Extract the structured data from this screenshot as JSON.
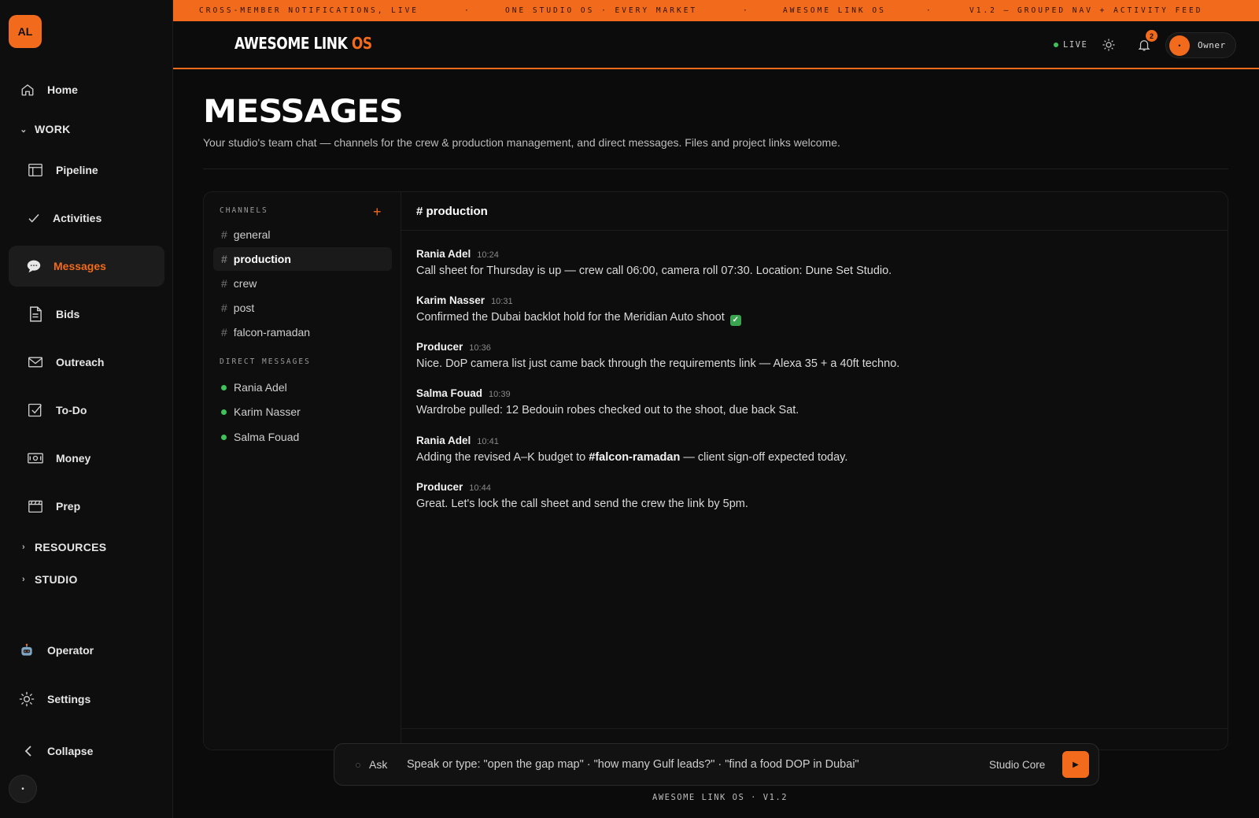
{
  "ticker": {
    "items": [
      "CROSS-MEMBER NOTIFICATIONS, LIVE",
      "·",
      "ONE STUDIO OS · EVERY MARKET",
      "·",
      "AWESOME LINK OS",
      "·",
      "V1.2 — GROUPED NAV + ACTIVITY FEED"
    ]
  },
  "sidebar": {
    "logo": "AL",
    "home": "Home",
    "work_group": "WORK",
    "work_items": [
      {
        "label": "Pipeline",
        "icon": "table-icon"
      },
      {
        "label": "Activities",
        "icon": "check-icon"
      },
      {
        "label": "Messages",
        "icon": "speech-bubble-icon"
      },
      {
        "label": "Bids",
        "icon": "document-icon"
      },
      {
        "label": "Outreach",
        "icon": "mail-icon"
      },
      {
        "label": "To-Do",
        "icon": "checkbox-icon"
      },
      {
        "label": "Money",
        "icon": "cash-icon"
      },
      {
        "label": "Prep",
        "icon": "clapperboard-icon"
      }
    ],
    "resources_group": "RESOURCES",
    "studio_group": "STUDIO",
    "operator": "Operator",
    "settings": "Settings",
    "collapse": "Collapse",
    "avatar": "•"
  },
  "header": {
    "brand_main": "AWESOME LINK ",
    "brand_accent": "OS",
    "live": "LIVE",
    "notif_count": "2",
    "owner_avatar": "•",
    "owner": "Owner"
  },
  "page": {
    "title": "MESSAGES",
    "subtitle": "Your studio's team chat — channels for the crew & production management, and direct messages. Files and project links welcome."
  },
  "channels": {
    "label": "CHANNELS",
    "add": "+",
    "items": [
      "general",
      "production",
      "crew",
      "post",
      "falcon-ramadan"
    ],
    "active_index": 1,
    "dm_label": "DIRECT MESSAGES",
    "dms": [
      "Rania Adel",
      "Karim Nasser",
      "Salma Fouad"
    ]
  },
  "chat": {
    "title": "# production",
    "messages": [
      {
        "author": "Rania Adel",
        "time": "10:24",
        "text": "Call sheet for Thursday is up — crew call 06:00, camera roll 07:30. Location: Dune Set Studio."
      },
      {
        "author": "Karim Nasser",
        "time": "10:31",
        "text": "Confirmed the Dubai backlot hold for the Meridian Auto shoot",
        "emoji": "✓"
      },
      {
        "author": "Producer",
        "time": "10:36",
        "text": "Nice. DoP camera list just came back through the requirements link — Alexa 35 + a 40ft techno."
      },
      {
        "author": "Salma Fouad",
        "time": "10:39",
        "text": "Wardrobe pulled: 12 Bedouin robes checked out to the shoot, due back Sat."
      },
      {
        "author": "Rania Adel",
        "time": "10:41",
        "text_before": "Adding the revised A–K budget to ",
        "mention": "#falcon-ramadan",
        "text_after": " — client sign-off expected today."
      },
      {
        "author": "Producer",
        "time": "10:44",
        "text": "Great. Let's lock the call sheet and send the crew the link by 5pm."
      }
    ]
  },
  "command": {
    "ask": "Ask",
    "placeholder": "Speak or type: \"open the gap map\" · \"how many Gulf leads?\" · \"find a food DOP in Dubai\"",
    "model": "Studio Core",
    "send": "▶"
  },
  "footer": "AWESOME LINK OS · V1.2",
  "colors": {
    "accent": "#f26a1b",
    "online": "#3ec25b",
    "background": "#0b0b0b"
  }
}
